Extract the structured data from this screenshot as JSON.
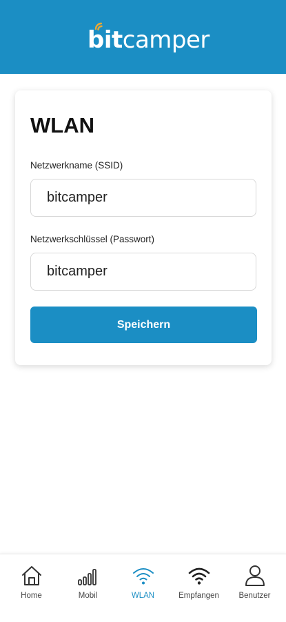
{
  "header": {
    "logo_bold": "bit",
    "logo_light": "camper"
  },
  "colors": {
    "brand": "#1b8ec4",
    "logo_signal": "#f0a830",
    "active_nav": "#1b8ec4",
    "inactive_nav": "#333333"
  },
  "card": {
    "title": "WLAN",
    "ssid": {
      "label": "Netzwerkname (SSID)",
      "value": "bitcamper"
    },
    "password": {
      "label": "Netzwerkschlüssel (Passwort)",
      "value": "bitcamper"
    },
    "save_label": "Speichern"
  },
  "nav": {
    "active": "WLAN",
    "items": [
      {
        "label": "Home",
        "icon": "home-icon"
      },
      {
        "label": "Mobil",
        "icon": "signal-bars-icon"
      },
      {
        "label": "WLAN",
        "icon": "wifi-icon"
      },
      {
        "label": "Empfangen",
        "icon": "wifi-receive-icon"
      },
      {
        "label": "Benutzer",
        "icon": "user-icon"
      }
    ]
  }
}
